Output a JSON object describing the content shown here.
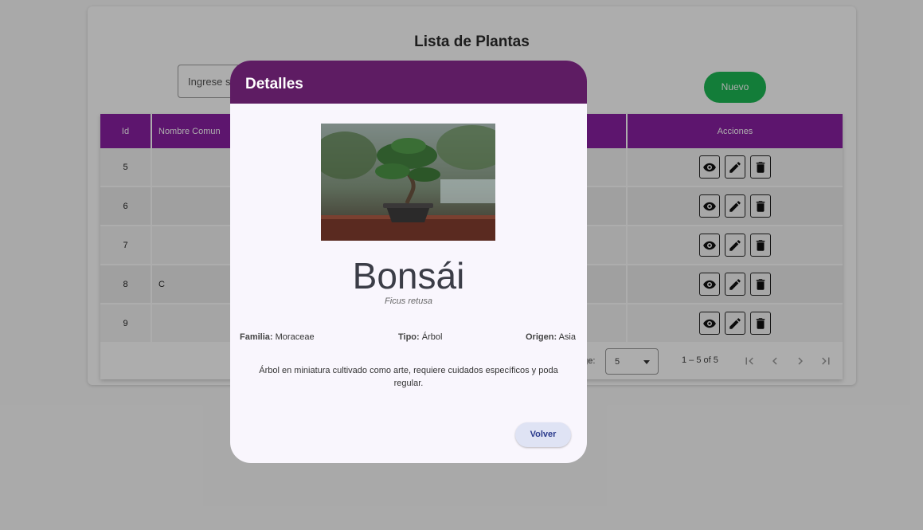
{
  "page": {
    "title": "Lista de Plantas",
    "search_placeholder": "Ingrese s",
    "new_button": "Nuevo"
  },
  "table": {
    "headers": {
      "id": "Id",
      "name": "Nombre Comun",
      "actions": "Acciones"
    },
    "rows": [
      {
        "id": "5",
        "name": ""
      },
      {
        "id": "6",
        "name": ""
      },
      {
        "id": "7",
        "name": ""
      },
      {
        "id": "8",
        "name": "C"
      },
      {
        "id": "9",
        "name": ""
      }
    ],
    "row_actions": [
      "eye-icon",
      "pencil-icon",
      "trash-icon"
    ]
  },
  "paginator": {
    "label": "age:",
    "page_size": "5",
    "range": "1 – 5 of 5"
  },
  "dialog": {
    "title": "Detalles",
    "plant_name": "Bonsái",
    "scientific_name": "Ficus retusa",
    "family_label": "Familia:",
    "family_value": "Moraceae",
    "type_label": "Tipo:",
    "type_value": "Árbol",
    "origin_label": "Origen:",
    "origin_value": "Asia",
    "description": "Árbol en miniatura cultivado como arte, requiere cuidados específicos y poda regular.",
    "back_button": "Volver"
  },
  "colors": {
    "table_header": "#8a1fa3",
    "dialog_header": "#5e1c63",
    "new_button": "#1db954",
    "back_button_bg": "#dfe3f4"
  }
}
